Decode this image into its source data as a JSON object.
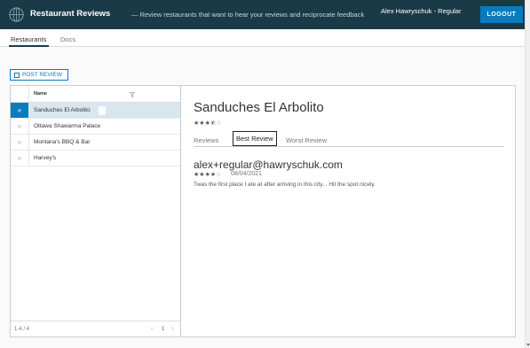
{
  "header": {
    "title": "Restaurant Reviews",
    "tagline": "— Review restaurants that want to hear your reviews and reciprocate feedback",
    "user": "Alex Hawryschuk - Regular",
    "logout_label": "LOGOUT"
  },
  "nav": {
    "tabs": [
      {
        "label": "Restaurants",
        "active": true
      },
      {
        "label": "Docs",
        "active": false
      }
    ]
  },
  "post_review_label": "POST REVIEW",
  "list": {
    "column_name": "Name",
    "rows": [
      {
        "label": "Sanduches El Arbolito",
        "selected": true
      },
      {
        "label": "Ottawa Shawarma Palace",
        "selected": false
      },
      {
        "label": "Montana's BBQ & Bar",
        "selected": false
      },
      {
        "label": "Harvey's",
        "selected": false
      }
    ],
    "footer_count": "1-4 / 4",
    "page": "1"
  },
  "detail": {
    "title": "Sanduches El Arbolito",
    "rating": 3.5,
    "tabs": [
      {
        "label": "Reviews",
        "active": false
      },
      {
        "label": "Best Review",
        "active": true
      },
      {
        "label": "Worst Review",
        "active": false
      }
    ],
    "review": {
      "author": "alex+regular@hawryschuk.com",
      "rating": 4,
      "date": "08/04/2021",
      "text": "Twas the first place I ate at after arriving in this city... Hit the spot nicely."
    }
  },
  "colors": {
    "header_bg": "#1b3a47",
    "accent": "#0a7bbd",
    "selected_row": "#d8e7ef"
  },
  "icons": {
    "brand": "globe-icon",
    "expand_selected": "chevron-double-left-icon",
    "expand": "chevron-double-right-icon",
    "filter": "filter-icon"
  }
}
